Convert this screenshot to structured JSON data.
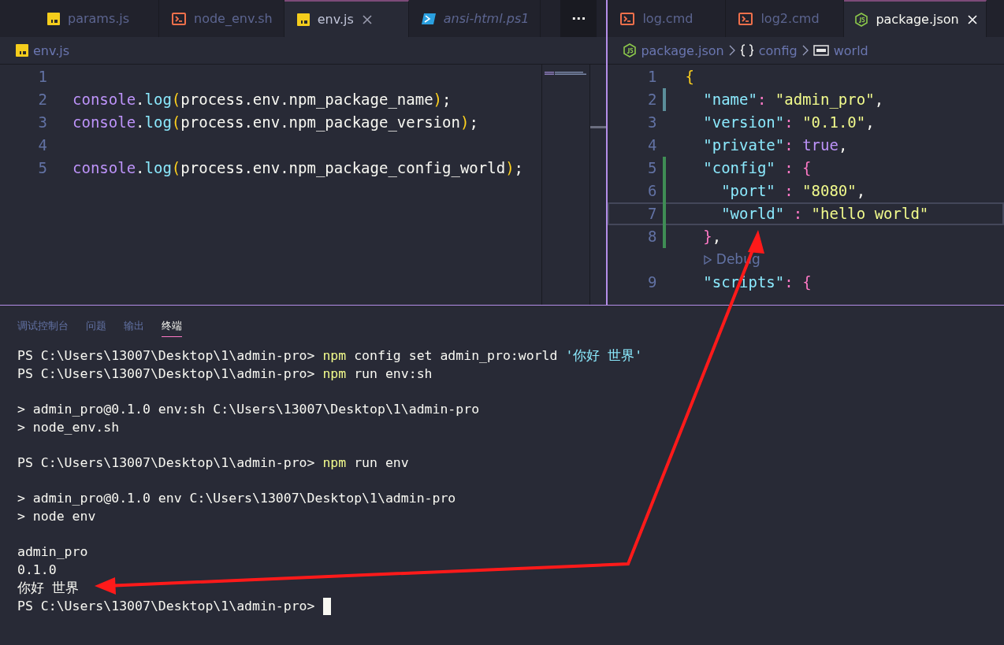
{
  "editor_groups": [
    {
      "tabs": [
        {
          "label": "params.js",
          "kind": "js",
          "selected": false,
          "preview": false
        },
        {
          "label": "node_env.sh",
          "kind": "shell",
          "selected": false,
          "preview": false
        },
        {
          "label": "env.js",
          "kind": "js",
          "selected": true,
          "preview": false
        },
        {
          "label": "ansi-html.ps1",
          "kind": "powershell",
          "selected": false,
          "preview": true
        }
      ],
      "more_button": "···",
      "breadcrumbs": [
        {
          "label": "env.js",
          "kind": "js"
        }
      ],
      "lines": [
        {
          "number": "1",
          "kind": "code"
        },
        {
          "number": "2",
          "kind": "code",
          "tokens": [
            {
              "kind": "object",
              "text": "console"
            },
            {
              "kind": "text",
              "text": "."
            },
            {
              "kind": "method",
              "text": "log"
            },
            {
              "kind": "paren",
              "text": "("
            },
            {
              "kind": "text",
              "text": "process.env.npm_package_name"
            },
            {
              "kind": "paren",
              "text": ")"
            },
            {
              "kind": "text",
              "text": ";"
            }
          ]
        },
        {
          "number": "3",
          "kind": "code",
          "tokens": [
            {
              "kind": "object",
              "text": "console"
            },
            {
              "kind": "text",
              "text": "."
            },
            {
              "kind": "method",
              "text": "log"
            },
            {
              "kind": "paren",
              "text": "("
            },
            {
              "kind": "text",
              "text": "process.env.npm_package_version"
            },
            {
              "kind": "paren",
              "text": ")"
            },
            {
              "kind": "text",
              "text": ";"
            }
          ]
        },
        {
          "number": "4",
          "kind": "code"
        },
        {
          "number": "5",
          "kind": "code",
          "tokens": [
            {
              "kind": "object",
              "text": "console"
            },
            {
              "kind": "text",
              "text": "."
            },
            {
              "kind": "method",
              "text": "log"
            },
            {
              "kind": "paren",
              "text": "("
            },
            {
              "kind": "text",
              "text": "process.env.npm_package_config_world"
            },
            {
              "kind": "paren",
              "text": ")"
            },
            {
              "kind": "text",
              "text": ";"
            }
          ]
        }
      ]
    },
    {
      "tabs": [
        {
          "label": "log.cmd",
          "kind": "shell",
          "selected": false,
          "preview": false
        },
        {
          "label": "log2.cmd",
          "kind": "shell",
          "selected": false,
          "preview": false
        },
        {
          "label": "package.json",
          "kind": "node",
          "selected": true,
          "preview": false
        }
      ],
      "breadcrumbs": [
        {
          "label": "package.json",
          "kind": "node"
        },
        {
          "label": "config",
          "kind": "braces"
        },
        {
          "label": "world",
          "kind": "string"
        }
      ],
      "lines": [
        {
          "number": "1",
          "kind": "code",
          "modified": false,
          "added": false,
          "current": false,
          "tokens": [
            {
              "kind": "brace",
              "text": "{"
            }
          ]
        },
        {
          "number": "2",
          "kind": "code",
          "modified": true,
          "added": false,
          "current": false,
          "tokens": [
            {
              "kind": "key",
              "text": "  \"name\""
            },
            {
              "kind": "colon",
              "text": ": "
            },
            {
              "kind": "string",
              "text": "\"admin_pro\""
            },
            {
              "kind": "text",
              "text": ","
            }
          ]
        },
        {
          "number": "3",
          "kind": "code",
          "modified": false,
          "added": false,
          "current": false,
          "tokens": [
            {
              "kind": "key",
              "text": "  \"version\""
            },
            {
              "kind": "colon",
              "text": ": "
            },
            {
              "kind": "string",
              "text": "\"0.1.0\""
            },
            {
              "kind": "text",
              "text": ","
            }
          ]
        },
        {
          "number": "4",
          "kind": "code",
          "modified": false,
          "added": false,
          "current": false,
          "tokens": [
            {
              "kind": "key",
              "text": "  \"private\""
            },
            {
              "kind": "colon",
              "text": ": "
            },
            {
              "kind": "bool",
              "text": "true"
            },
            {
              "kind": "text",
              "text": ","
            }
          ]
        },
        {
          "number": "5",
          "kind": "code",
          "modified": false,
          "added": true,
          "current": false,
          "tokens": [
            {
              "kind": "key",
              "text": "  \"config\""
            },
            {
              "kind": "colon",
              "text": " : "
            },
            {
              "kind": "brace2",
              "text": "{"
            }
          ]
        },
        {
          "number": "6",
          "kind": "code",
          "modified": false,
          "added": true,
          "current": false,
          "tokens": [
            {
              "kind": "key",
              "text": "    \"port\""
            },
            {
              "kind": "colon",
              "text": " : "
            },
            {
              "kind": "string",
              "text": "\"8080\""
            },
            {
              "kind": "text",
              "text": ","
            }
          ]
        },
        {
          "number": "7",
          "kind": "code",
          "modified": false,
          "added": true,
          "current": true,
          "tokens": [
            {
              "kind": "key",
              "text": "    \"world\""
            },
            {
              "kind": "colon",
              "text": " : "
            },
            {
              "kind": "string",
              "text": "\"hello world\""
            }
          ]
        },
        {
          "number": "8",
          "kind": "code",
          "modified": false,
          "added": true,
          "current": false,
          "tokens": [
            {
              "kind": "brace2",
              "text": "  }"
            },
            {
              "kind": "text",
              "text": ","
            }
          ]
        },
        {
          "kind": "codelens",
          "text": "Debug"
        },
        {
          "number": "9",
          "kind": "code",
          "modified": false,
          "added": false,
          "current": false,
          "tokens": [
            {
              "kind": "key",
              "text": "  \"scripts\""
            },
            {
              "kind": "colon",
              "text": ": "
            },
            {
              "kind": "brace2",
              "text": "{"
            }
          ]
        }
      ]
    }
  ],
  "panel": {
    "tabs": [
      {
        "label": "调试控制台",
        "selected": false
      },
      {
        "label": "问题",
        "selected": false
      },
      {
        "label": "输出",
        "selected": false
      },
      {
        "label": "终端",
        "selected": true
      }
    ],
    "terminal_lines": [
      {
        "segments": [
          {
            "kind": "prompt",
            "text": "PS C:\\Users\\13007\\Desktop\\1\\admin-pro> "
          },
          {
            "kind": "command",
            "text": "npm"
          },
          {
            "kind": "plain",
            "text": " config set admin_pro:world "
          },
          {
            "kind": "string",
            "text": "'你好 世界'"
          }
        ]
      },
      {
        "segments": [
          {
            "kind": "prompt",
            "text": "PS C:\\Users\\13007\\Desktop\\1\\admin-pro> "
          },
          {
            "kind": "command",
            "text": "npm"
          },
          {
            "kind": "plain",
            "text": " run env:sh"
          }
        ]
      },
      {
        "kind": "blank"
      },
      {
        "segments": [
          {
            "kind": "plain",
            "text": "> admin_pro@0.1.0 env:sh C:\\Users\\13007\\Desktop\\1\\admin-pro"
          }
        ]
      },
      {
        "segments": [
          {
            "kind": "plain",
            "text": "> node_env.sh"
          }
        ]
      },
      {
        "kind": "blank"
      },
      {
        "segments": [
          {
            "kind": "prompt",
            "text": "PS C:\\Users\\13007\\Desktop\\1\\admin-pro> "
          },
          {
            "kind": "command",
            "text": "npm"
          },
          {
            "kind": "plain",
            "text": " run env"
          }
        ]
      },
      {
        "kind": "blank"
      },
      {
        "segments": [
          {
            "kind": "plain",
            "text": "> admin_pro@0.1.0 env C:\\Users\\13007\\Desktop\\1\\admin-pro"
          }
        ]
      },
      {
        "segments": [
          {
            "kind": "plain",
            "text": "> node env"
          }
        ]
      },
      {
        "kind": "blank"
      },
      {
        "segments": [
          {
            "kind": "plain",
            "text": "admin_pro"
          }
        ]
      },
      {
        "segments": [
          {
            "kind": "plain",
            "text": "0.1.0"
          }
        ]
      },
      {
        "segments": [
          {
            "kind": "plain",
            "text": "你好 世界"
          }
        ]
      },
      {
        "segments": [
          {
            "kind": "prompt",
            "text": "PS C:\\Users\\13007\\Desktop\\1\\admin-pro>"
          }
        ],
        "cursor": true
      }
    ]
  }
}
